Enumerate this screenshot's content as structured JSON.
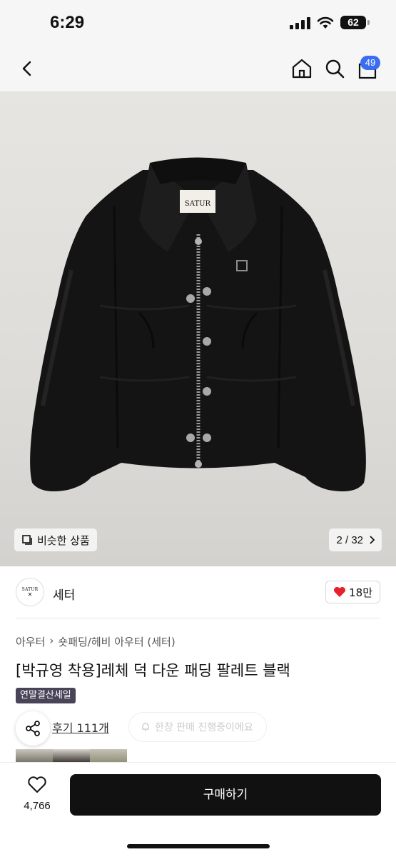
{
  "status_bar": {
    "time": "6:29",
    "battery": "62"
  },
  "header": {
    "cart_count": "49"
  },
  "gallery": {
    "similar_label": "비슷한 상품",
    "page_indicator": "2 / 32",
    "label_text": "SATUR"
  },
  "shop": {
    "logo_text": "SATUR",
    "name": "세터",
    "likes": "18만"
  },
  "product": {
    "breadcrumb": [
      "아우터",
      "숏패딩/헤비 아우터 (세터)"
    ],
    "title": "[박규영 착용]레체 덕 다운 패딩 팔레트 블랙",
    "badge": "연말결산세일",
    "review_link": "후기 111개",
    "sale_notice": "한창 판매 진행중이에요"
  },
  "bottom_bar": {
    "wish_count": "4,766",
    "buy_label": "구매하기"
  },
  "colors": {
    "accent_blue": "#3a6df0",
    "heart_red": "#e8202a",
    "badge_purple": "#4a4458",
    "buy_black": "#111111"
  }
}
